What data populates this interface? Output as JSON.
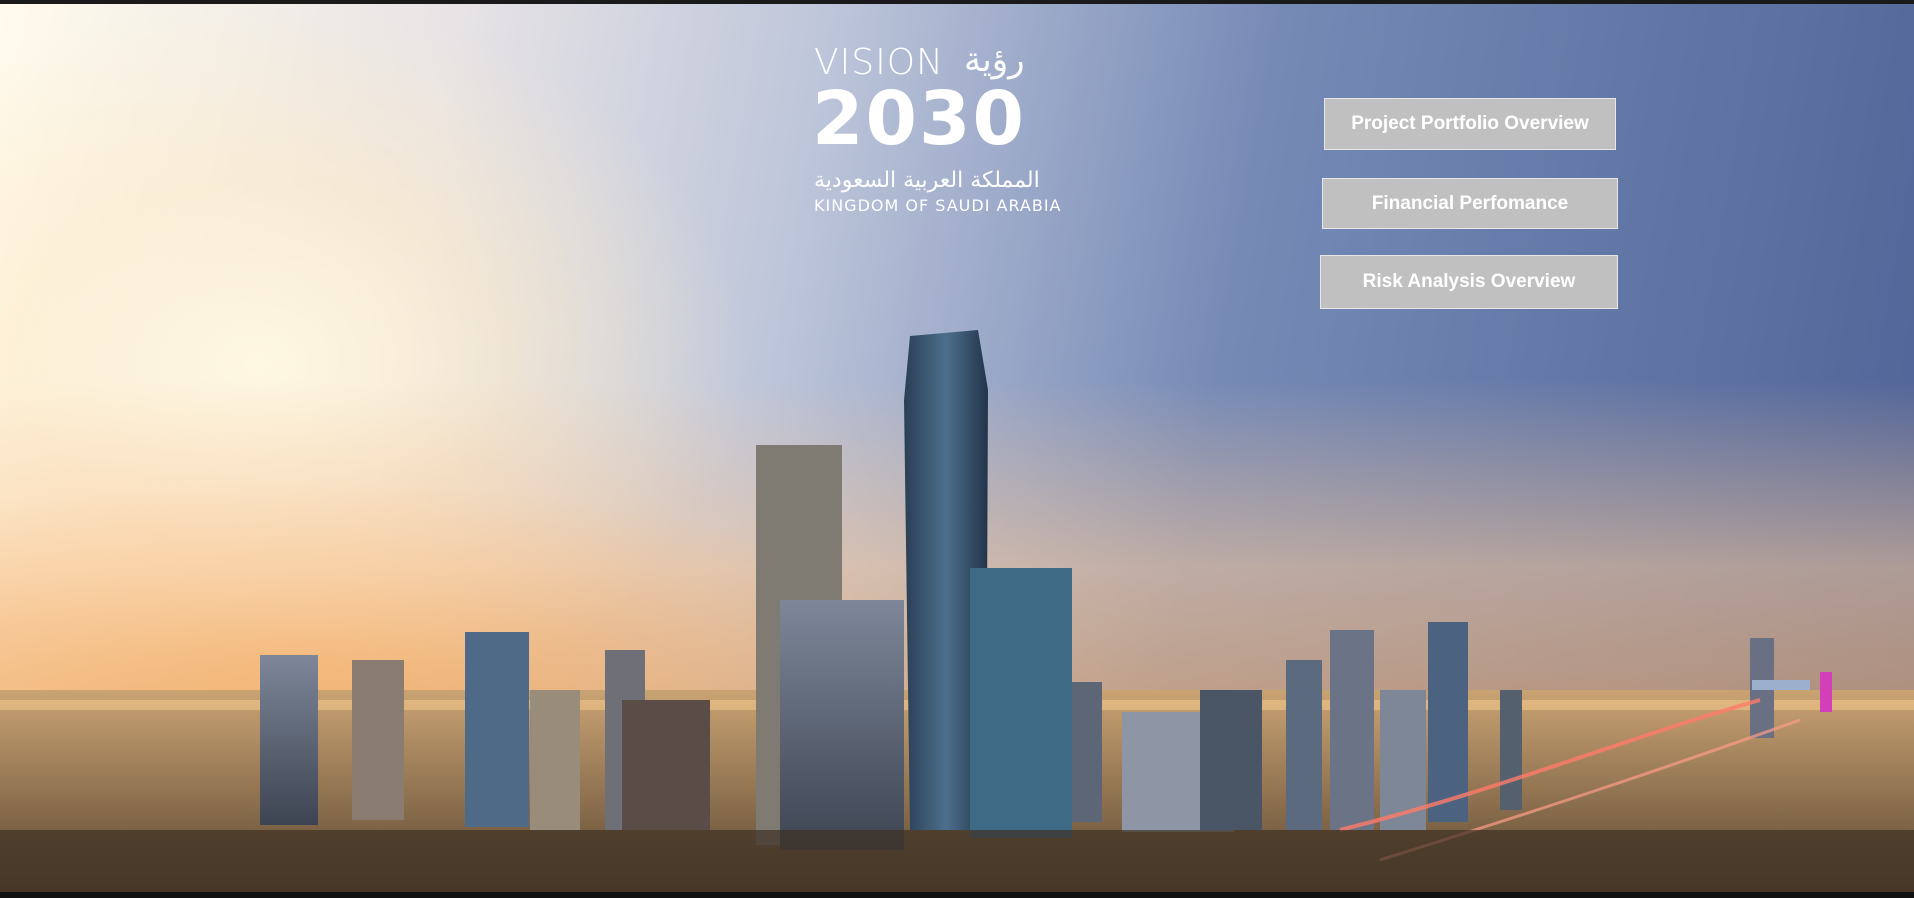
{
  "logo": {
    "vision": "VISION",
    "arabic_vision": "رؤية",
    "year": "2030",
    "arabic_kingdom": "المملكة العربية السعودية",
    "kingdom": "KINGDOM OF SAUDI ARABIA"
  },
  "nav": {
    "project_portfolio": "Project Portfolio Overview",
    "financial": "Financial Perfomance",
    "risk": "Risk Analysis Overview"
  },
  "colors": {
    "button_bg": "#c0c0c0",
    "button_text": "#ffffff"
  }
}
